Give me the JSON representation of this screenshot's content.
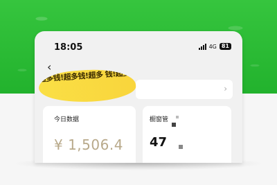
{
  "status_bar": {
    "time": "18:05",
    "network": "4G",
    "battery": "81"
  },
  "overlay": {
    "highlight_text": "!超多钱!超多钱!超多 钱!超多钱!超多钱!超 多钱!超多钱!超多钱!"
  },
  "cards": {
    "today": {
      "label": "今日数据",
      "value": "¥ 1,506.4"
    },
    "window": {
      "label": "橱窗管",
      "value": "47"
    }
  },
  "icons": {
    "back": "chevron-left-icon",
    "more": "chevron-right-icon",
    "signal": "signal-bars-icon",
    "battery": "battery-icon"
  },
  "colors": {
    "background_green": "#22b22d",
    "highlight_yellow": "#fade3c",
    "muted_value": "#b8a98a"
  }
}
